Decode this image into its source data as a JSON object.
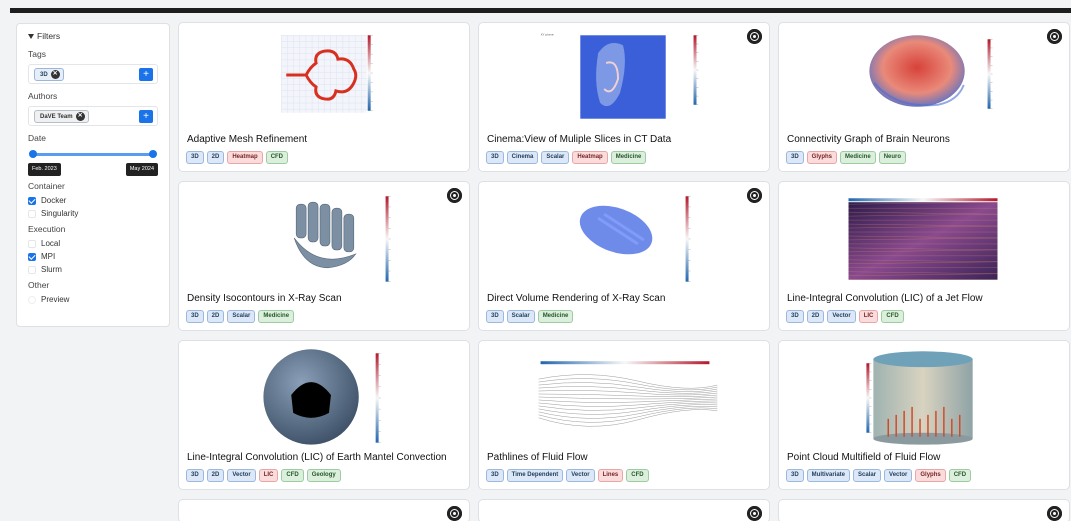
{
  "sidebar": {
    "filters_label": "Filters",
    "tags_label": "Tags",
    "tag_chip": "3D",
    "authors_label": "Authors",
    "author_chip": "DaVE Team",
    "date_label": "Date",
    "date_start": "Feb. 2023",
    "date_end": "May 2024",
    "container_label": "Container",
    "container_docker": "Docker",
    "container_singularity": "Singularity",
    "execution_label": "Execution",
    "exec_local": "Local",
    "exec_mpi": "MPI",
    "exec_slurm": "Slurm",
    "other_label": "Other",
    "other_preview": "Preview",
    "checked": {
      "docker": true,
      "singularity": false,
      "local": false,
      "mpi": true,
      "slurm": false,
      "preview": false
    }
  },
  "cards": [
    {
      "title": "Adaptive Mesh Refinement",
      "docker": false,
      "tags": [
        [
          "3D",
          "blue"
        ],
        [
          "2D",
          "blue"
        ],
        [
          "Heatmap",
          "red"
        ],
        [
          "CFD",
          "green"
        ]
      ]
    },
    {
      "title": "Cinema:View of Muliple Slices in CT Data",
      "docker": true,
      "tags": [
        [
          "3D",
          "blue"
        ],
        [
          "Cinema",
          "blue"
        ],
        [
          "Scalar",
          "blue"
        ],
        [
          "Heatmap",
          "red"
        ],
        [
          "Medicine",
          "green"
        ]
      ]
    },
    {
      "title": "Connectivity Graph of Brain Neurons",
      "docker": true,
      "tags": [
        [
          "3D",
          "blue"
        ],
        [
          "Glyphs",
          "red"
        ],
        [
          "Medicine",
          "green"
        ],
        [
          "Neuro",
          "green"
        ]
      ]
    },
    {
      "title": "Density Isocontours in X-Ray Scan",
      "docker": true,
      "tags": [
        [
          "3D",
          "blue"
        ],
        [
          "2D",
          "blue"
        ],
        [
          "Scalar",
          "blue"
        ],
        [
          "Medicine",
          "green"
        ]
      ]
    },
    {
      "title": "Direct Volume Rendering of X-Ray Scan",
      "docker": true,
      "tags": [
        [
          "3D",
          "blue"
        ],
        [
          "Scalar",
          "blue"
        ],
        [
          "Medicine",
          "green"
        ]
      ]
    },
    {
      "title": "Line-Integral Convolution (LIC) of a Jet Flow",
      "docker": false,
      "tags": [
        [
          "3D",
          "blue"
        ],
        [
          "2D",
          "blue"
        ],
        [
          "Vector",
          "blue"
        ],
        [
          "LIC",
          "red"
        ],
        [
          "CFD",
          "green"
        ]
      ]
    },
    {
      "title": "Line-Integral Convolution (LIC) of Earth Mantel Convection",
      "docker": false,
      "tags": [
        [
          "3D",
          "blue"
        ],
        [
          "2D",
          "blue"
        ],
        [
          "Vector",
          "blue"
        ],
        [
          "LIC",
          "red"
        ],
        [
          "CFD",
          "green"
        ],
        [
          "Geology",
          "green"
        ]
      ]
    },
    {
      "title": "Pathlines of Fluid Flow",
      "docker": false,
      "tags": [
        [
          "3D",
          "blue"
        ],
        [
          "Time Dependent",
          "blue"
        ],
        [
          "Vector",
          "blue"
        ],
        [
          "Lines",
          "red"
        ],
        [
          "CFD",
          "green"
        ]
      ]
    },
    {
      "title": "Point Cloud Multifield of Fluid Flow",
      "docker": false,
      "tags": [
        [
          "3D",
          "blue"
        ],
        [
          "Multivariate",
          "blue"
        ],
        [
          "Scalar",
          "blue"
        ],
        [
          "Vector",
          "blue"
        ],
        [
          "Glyphs",
          "red"
        ],
        [
          "CFD",
          "green"
        ]
      ]
    }
  ],
  "icons": {
    "docker": "docker-icon",
    "filter_toggle": "triangle-down-icon",
    "add": "plus-icon",
    "remove": "close-icon"
  }
}
